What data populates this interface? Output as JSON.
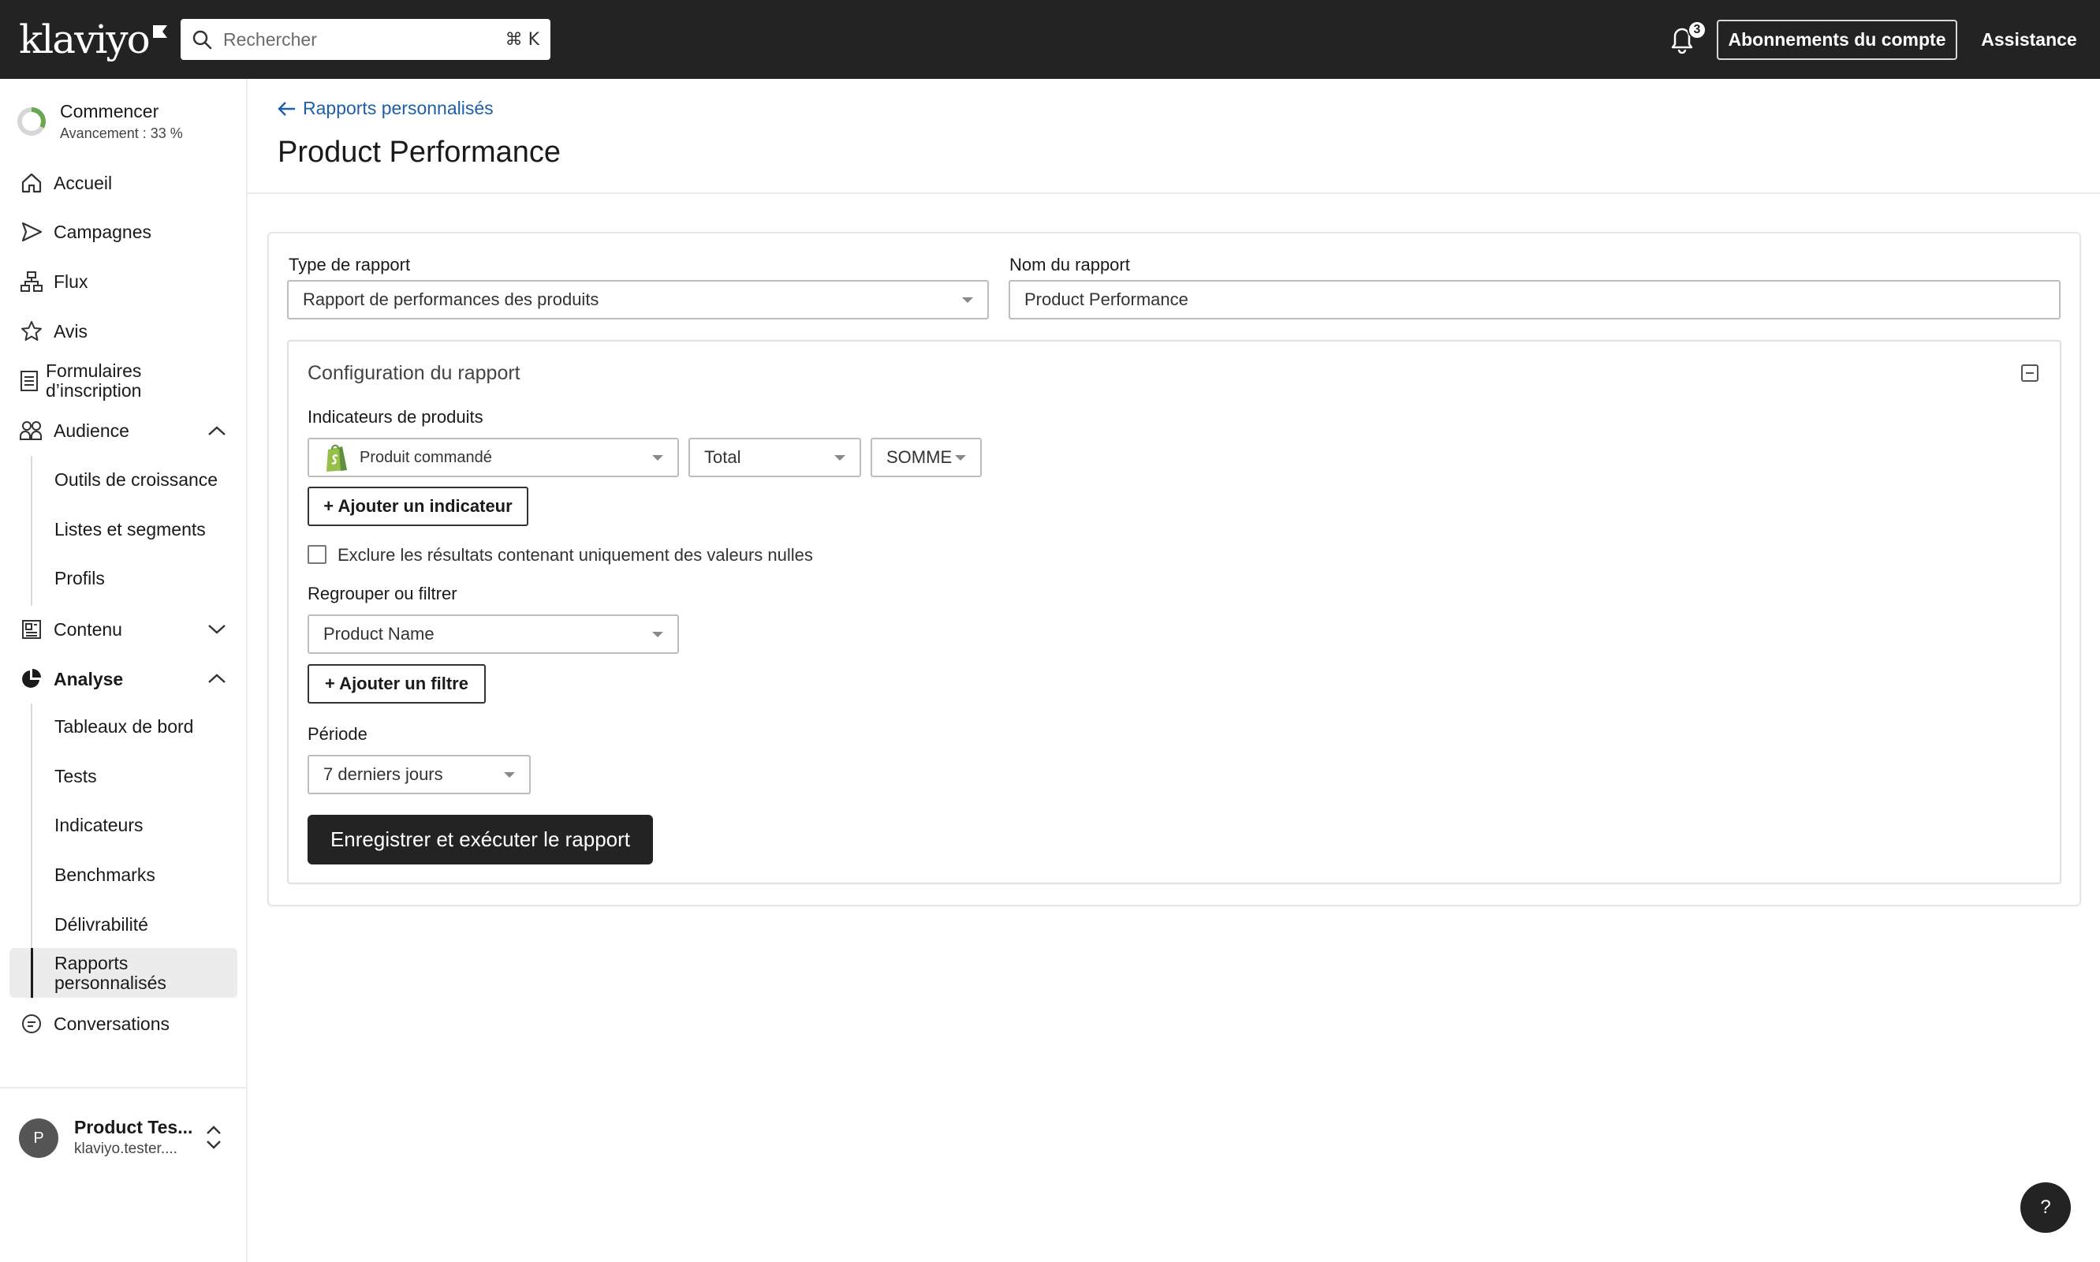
{
  "topbar": {
    "logo_text": "klaviyo",
    "search_placeholder": "Rechercher",
    "search_shortcut": "⌘ K",
    "notification_count": "3",
    "account_subscriptions_label": "Abonnements du compte",
    "assistance_label": "Assistance"
  },
  "sidebar": {
    "progress": {
      "title": "Commencer",
      "subtitle": "Avancement : 33 %",
      "percent": 33
    },
    "items": {
      "home": "Accueil",
      "campaigns": "Campagnes",
      "flows": "Flux",
      "reviews": "Avis",
      "signup_forms": "Formulaires d’inscription",
      "audience": "Audience",
      "content": "Contenu",
      "analytics": "Analyse",
      "conversations": "Conversations"
    },
    "audience_sub": [
      "Outils de croissance",
      "Listes et segments",
      "Profils"
    ],
    "analytics_sub": [
      "Tableaux de bord",
      "Tests",
      "Indicateurs",
      "Benchmarks",
      "Délivrabilité",
      "Rapports personnalisés"
    ],
    "account": {
      "avatar_letter": "P",
      "name": "Product Tes...",
      "email": "klaviyo.tester...."
    }
  },
  "main": {
    "back_link": "Rapports personnalisés",
    "title": "Product Performance",
    "report_type_label": "Type de rapport",
    "report_type_value": "Rapport de performances des produits",
    "report_name_label": "Nom du rapport",
    "report_name_value": "Product Performance",
    "config": {
      "title": "Configuration du rapport",
      "metrics_label": "Indicateurs de produits",
      "metric_value": "Produit commandé",
      "measure_value": "Total",
      "aggregation_value": "SOMME",
      "add_metric_label": "+ Ajouter un indicateur",
      "exclude_label": "Exclure les résultats contenant uniquement des valeurs nulles",
      "group_label": "Regrouper ou filtrer",
      "group_value": "Product Name",
      "add_filter_label": "+ Ajouter un filtre",
      "period_label": "Période",
      "period_value": "7 derniers jours",
      "submit_label": "Enregistrer et exécuter le rapport"
    }
  },
  "help_fab_label": "?"
}
